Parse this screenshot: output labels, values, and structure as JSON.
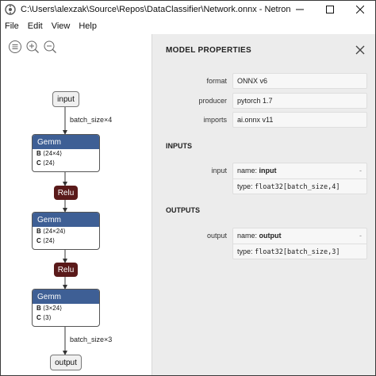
{
  "window": {
    "title": "C:\\Users\\alexzak\\Source\\Repos\\DataClassifier\\Network.onnx - Netron",
    "icons": [
      "app-icon",
      "minimize-icon",
      "maximize-icon",
      "close-icon"
    ]
  },
  "menu": [
    "File",
    "Edit",
    "View",
    "Help"
  ],
  "toolbar": {
    "icons": [
      "sidebar-menu-icon",
      "zoom-in-icon",
      "zoom-out-icon"
    ]
  },
  "graph": {
    "input_label": "input",
    "output_label": "output",
    "edge_in": "batch_size×4",
    "edge_out": "batch_size×3",
    "nodes": [
      {
        "op": "Gemm",
        "attrs": [
          {
            "k": "B",
            "v": "⟨24×4⟩"
          },
          {
            "k": "C",
            "v": "⟨24⟩"
          }
        ]
      },
      {
        "op": "Relu"
      },
      {
        "op": "Gemm",
        "attrs": [
          {
            "k": "B",
            "v": "⟨24×24⟩"
          },
          {
            "k": "C",
            "v": "⟨24⟩"
          }
        ]
      },
      {
        "op": "Relu"
      },
      {
        "op": "Gemm",
        "attrs": [
          {
            "k": "B",
            "v": "⟨3×24⟩"
          },
          {
            "k": "C",
            "v": "⟨3⟩"
          }
        ]
      }
    ],
    "colors": {
      "gemm": "#3e5f95",
      "relu": "#5a1a1a"
    }
  },
  "properties": {
    "title": "MODEL PROPERTIES",
    "rows": [
      {
        "key": "format",
        "value": "ONNX v6"
      },
      {
        "key": "producer",
        "value": "pytorch 1.7"
      },
      {
        "key": "imports",
        "value": "ai.onnx v11"
      }
    ],
    "inputs_heading": "INPUTS",
    "input": {
      "key": "input",
      "name_prefix": "name: ",
      "name": "input",
      "type_prefix": "type: ",
      "type": "float32[batch_size,4]"
    },
    "outputs_heading": "OUTPUTS",
    "output": {
      "key": "output",
      "name_prefix": "name: ",
      "name": "output",
      "type_prefix": "type: ",
      "type": "float32[batch_size,3]"
    },
    "expander": "-"
  }
}
